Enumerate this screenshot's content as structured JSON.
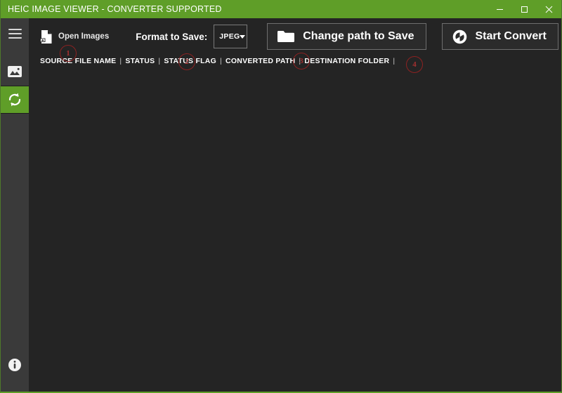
{
  "window": {
    "title": "HEIC IMAGE VIEWER - CONVERTER SUPPORTED",
    "accent_color": "#5f9e28",
    "background_color": "#242424",
    "sidebar_color": "#3a3a3a",
    "controls": {
      "minimize": "minimize-icon",
      "maximize": "maximize-icon",
      "close": "close-icon"
    }
  },
  "sidebar": {
    "items": [
      {
        "icon": "hamburger-menu-icon",
        "name": "menu"
      },
      {
        "icon": "image-icon",
        "name": "images"
      },
      {
        "icon": "convert-refresh-icon",
        "name": "converter",
        "active": true
      }
    ],
    "footer": {
      "icon": "info-icon",
      "name": "info"
    }
  },
  "toolbar": {
    "open_images_label": "Open Images",
    "open_images_icon": "document-add-icon",
    "format_label": "Format to Save:",
    "format_value": "JPEG",
    "format_options": [
      "JPEG"
    ],
    "change_path_label": "Change path to Save",
    "change_path_icon": "folder-icon",
    "start_convert_label": "Start Convert",
    "start_convert_icon": "sync-convert-icon"
  },
  "table": {
    "columns": [
      "SOURCE FILE NAME",
      "STATUS",
      "STATUS FLAG",
      "CONVERTED PATH",
      "DESTINATION FOLDER"
    ],
    "separator": "|",
    "rows": []
  },
  "annotations": [
    {
      "number": "1",
      "target": "open-images-button"
    },
    {
      "number": "2",
      "target": "format-select"
    },
    {
      "number": "3",
      "target": "change-path-button"
    },
    {
      "number": "4",
      "target": "start-convert-button"
    }
  ]
}
